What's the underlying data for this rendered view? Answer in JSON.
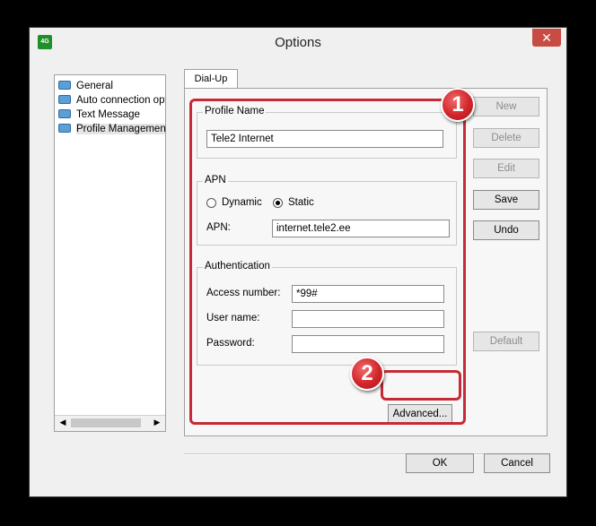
{
  "window": {
    "title": "Options",
    "app_icon_text": "4G",
    "close_symbol": "✕"
  },
  "tree": {
    "items": [
      {
        "label": "General",
        "icon": "folder-icon"
      },
      {
        "label": "Auto connection opti",
        "icon": "folder-icon"
      },
      {
        "label": "Text Message",
        "icon": "folder-icon"
      },
      {
        "label": "Profile Management",
        "icon": "folder-open-icon",
        "selected": true
      }
    ],
    "scroll_left": "◀",
    "scroll_right": "▶"
  },
  "tab": {
    "label": "Dial-Up"
  },
  "profile": {
    "group_label": "Profile Name",
    "name_value": "Tele2 Internet"
  },
  "apn": {
    "group_label": "APN",
    "dynamic_label": "Dynamic",
    "static_label": "Static",
    "selected": "Static",
    "apn_label": "APN:",
    "apn_value": "internet.tele2.ee"
  },
  "auth": {
    "group_label": "Authentication",
    "access_number_label": "Access number:",
    "access_number_value": "*99#",
    "user_name_label": "User name:",
    "user_name_value": "",
    "password_label": "Password:",
    "password_value": ""
  },
  "buttons": {
    "new": "New",
    "delete": "Delete",
    "edit": "Edit",
    "save": "Save",
    "undo": "Undo",
    "default": "Default",
    "advanced": "Advanced...",
    "ok": "OK",
    "cancel": "Cancel"
  },
  "callouts": {
    "one": "1",
    "two": "2",
    "color": "#c62a34"
  }
}
